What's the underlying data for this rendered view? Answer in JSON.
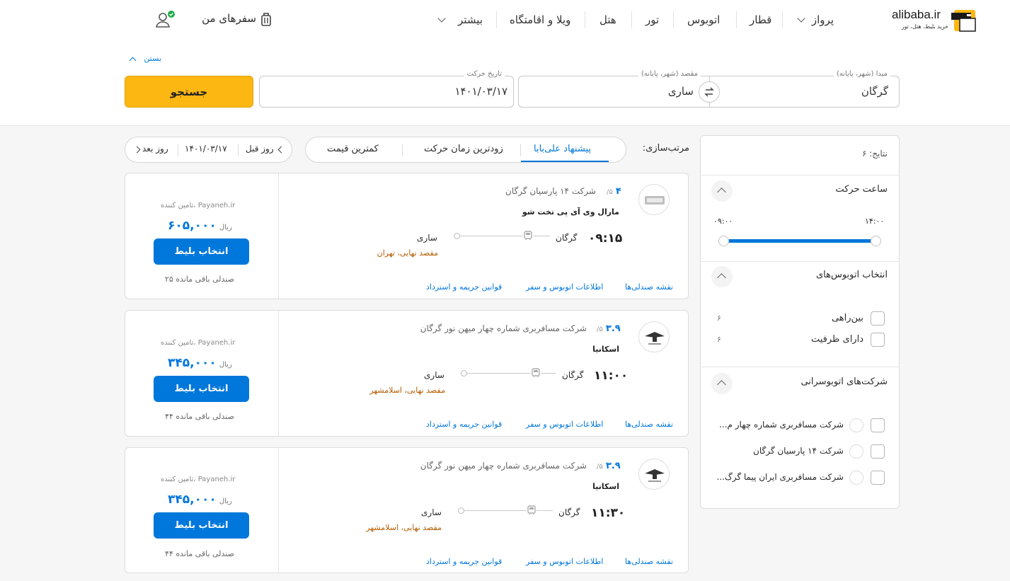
{
  "brand": {
    "name": "alibaba.ir",
    "tagline": "خرید بلیط، هتل، تور"
  },
  "nav": {
    "items": [
      "پرواز",
      "قطار",
      "اتوبوس",
      "تور",
      "هتل",
      "ویلا و اقامتگاه",
      "بیشتر"
    ],
    "my_trips": "سفرهای من"
  },
  "search": {
    "close_label": "بستن",
    "origin": {
      "label": "مبدا (شهر، پایانه)",
      "value": "گرگان"
    },
    "destination": {
      "label": "مقصد (شهر، پایانه)",
      "value": "ساری"
    },
    "date": {
      "label": "تاریخ حرکت",
      "value": "۱۴۰۱/۰۳/۱۷"
    },
    "button": "جستجو"
  },
  "sort": {
    "label": "مرتب‌سازی:",
    "options": [
      "پیشنهاد علی‌بابا",
      "زودترین زمان حرکت",
      "کمترین قیمت"
    ],
    "active": "پیشنهاد علی‌بابا"
  },
  "day_nav": {
    "prev": "روز قبل",
    "date": "۱۴۰۱/۰۳/۱۷",
    "next": "روز بعد"
  },
  "results": [
    {
      "rating": "۴",
      "rating_max": "/۵",
      "company": "شرکت ۱۴ پارسیان گرگان",
      "bus_type": "مارال وی آی پی تخت شو",
      "time": "۰۹:۱۵",
      "origin": "گرگان",
      "destination": "ساری",
      "final_dest": "مقصد نهایی، تهران",
      "links": [
        "نقشه صندلی‌ها",
        "اطلاعات اتوبوس و سفر",
        "قوانین جریمه و استرداد"
      ],
      "provider": "تامین کننده، Payaneh.ir",
      "price": "۶۰۵,۰۰۰",
      "currency": "ریال",
      "select": "انتخاب بلیط",
      "seats": "۲۵ صندلی باقی مانده"
    },
    {
      "rating": "۳.۹",
      "rating_max": "/۵",
      "company": "شرکت مسافربری شماره چهار میهن نور گرگان",
      "bus_type": "اسکانیا",
      "time": "۱۱:۰۰",
      "origin": "گرگان",
      "destination": "ساری",
      "final_dest": "مقصد نهایی، اسلامشهر",
      "links": [
        "نقشه صندلی‌ها",
        "اطلاعات اتوبوس و سفر",
        "قوانین جریمه و استرداد"
      ],
      "provider": "تامین کننده، Payaneh.ir",
      "price": "۳۴۵,۰۰۰",
      "currency": "ریال",
      "select": "انتخاب بلیط",
      "seats": "۴۴ صندلی باقی مانده"
    },
    {
      "rating": "۳.۹",
      "rating_max": "/۵",
      "company": "شرکت مسافربری شماره چهار میهن نور گرگان",
      "bus_type": "اسکانیا",
      "time": "۱۱:۳۰",
      "origin": "گرگان",
      "destination": "ساری",
      "final_dest": "مقصد نهایی، اسلامشهر",
      "links": [
        "نقشه صندلی‌ها",
        "اطلاعات اتوبوس و سفر",
        "قوانین جریمه و استرداد"
      ],
      "provider": "تامین کننده، Payaneh.ir",
      "price": "۳۴۵,۰۰۰",
      "currency": "ریال",
      "select": "انتخاب بلیط",
      "seats": "۴۴ صندلی باقی مانده"
    }
  ],
  "filters": {
    "results_count": "نتایج: ۶",
    "departure": {
      "title": "ساعت حرکت",
      "min": "۰۹:۰۰",
      "max": "۱۴:۰۰"
    },
    "bus_types": {
      "title": "انتخاب اتوبوس‌های",
      "options": [
        {
          "label": "بین‌راهی",
          "count": "۶"
        },
        {
          "label": "دارای ظرفیت",
          "count": "۶"
        }
      ]
    },
    "companies": {
      "title": "شرکت‌های اتوبوسرانی",
      "options": [
        "شرکت مسافربری شماره چهار م...",
        "شرکت ۱۴ پارسیان گرگان",
        "شرکت مسافربری ایران پیما گرگ..."
      ]
    }
  },
  "colors": {
    "accent": "#0077db",
    "search_button": "#fdb713",
    "rating": "#0077db",
    "final_dest": "#b35c00"
  }
}
